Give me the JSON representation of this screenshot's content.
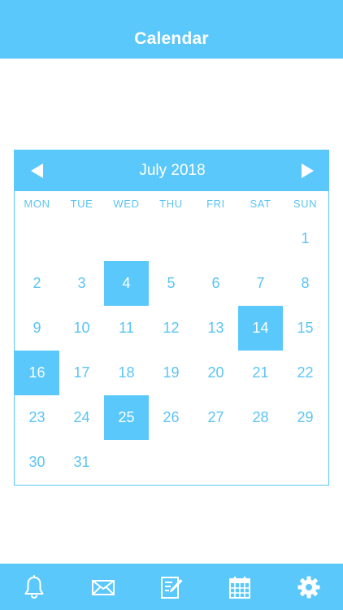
{
  "header": {
    "title": "Calendar"
  },
  "calendar": {
    "month_label": "July 2018",
    "weekdays": [
      "MON",
      "TUE",
      "WED",
      "THU",
      "FRI",
      "SAT",
      "SUN"
    ],
    "leading_blanks": 6,
    "days_in_month": 31,
    "selected_days": [
      4,
      14,
      16,
      25
    ]
  },
  "tabbar": {
    "items": [
      {
        "icon": "bell-icon"
      },
      {
        "icon": "mail-icon"
      },
      {
        "icon": "notes-icon"
      },
      {
        "icon": "calendar-icon"
      },
      {
        "icon": "gear-icon"
      }
    ]
  },
  "colors": {
    "accent": "#5bc8fb",
    "text": "#5bc4f4",
    "background": "#ffffff"
  }
}
